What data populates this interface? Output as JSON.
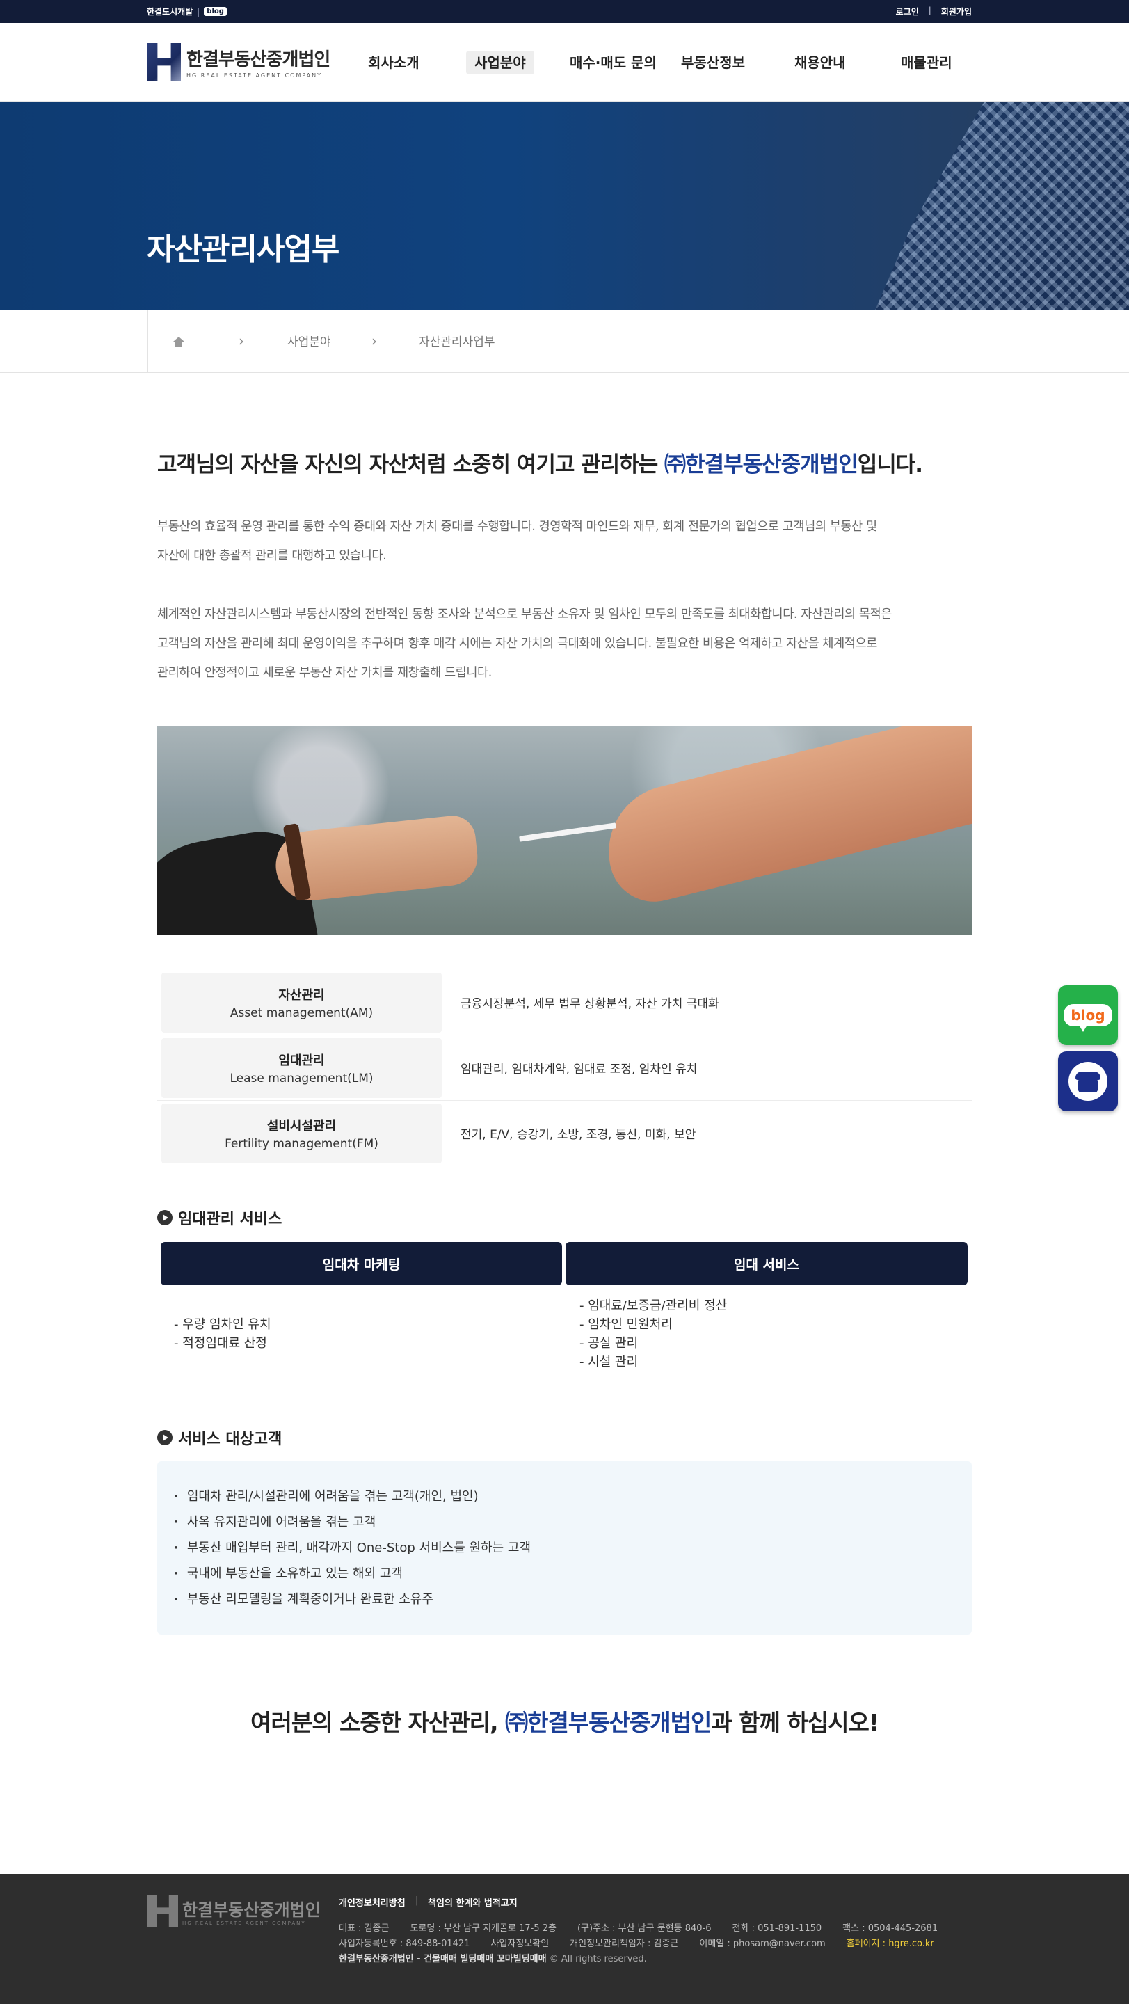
{
  "topbar": {
    "site_link": "한결도시개발",
    "blog_chip": "blog",
    "login": "로그인",
    "separator": "|",
    "signup": "회원가입"
  },
  "header": {
    "logo_ko": "한결부동산중개법인",
    "logo_en": "HG REAL ESTATE AGENT COMPANY",
    "nav": [
      "회사소개",
      "사업분야",
      "매수·매도 문의",
      "부동산정보",
      "채용안내",
      "매물관리"
    ],
    "active_nav": "사업분야"
  },
  "hero": {
    "title": "자산관리사업부"
  },
  "breadcrumb": {
    "level1": "사업분야",
    "level2": "자산관리사업부"
  },
  "intro": {
    "headline_pre": "고객님의 자산을 자신의 자산처럼 소중히 여기고 관리하는 ",
    "headline_company": "㈜한결부동산중개법인",
    "headline_post": "입니다.",
    "para1_line1": "부동산의 효율적 운영 관리를 통한 수익 증대와 자산 가치 증대를 수행합니다. 경영학적 마인드와 재무, 회계 전문가의 협업으로 고객님의 부동산 및",
    "para1_line2": "자산에 대한 총괄적 관리를 대행하고 있습니다.",
    "para2_line1": "체계적인 자산관리시스템과 부동산시장의 전반적인 동향 조사와 분석으로 부동산 소유자 및 임차인 모두의 만족도를 최대화합니다. 자산관리의 목적은",
    "para2_line2": "고객님의 자산을 관리해 최대 운영이익을 추구하며 향후 매각 시에는 자산 가치의 극대화에 있습니다. 불필요한 비용은 억제하고 자산을 체계적으로",
    "para2_line3": "관리하여 안정적이고 새로운 부동산 자산 가치를 재창출해 드립니다."
  },
  "services": [
    {
      "name_ko": "자산관리",
      "name_en": "Asset management(AM)",
      "desc": "금융시장분석, 세무 법무 상황분석, 자산 가치 극대화"
    },
    {
      "name_ko": "임대관리",
      "name_en": "Lease management(LM)",
      "desc": "임대관리, 임대차계약, 임대료 조정, 임차인 유치"
    },
    {
      "name_ko": "설비시설관리",
      "name_en": "Fertility management(FM)",
      "desc": "전기, E/V, 승강기, 소방, 조경, 통신, 미화, 보안"
    }
  ],
  "lease_section": {
    "title": "임대관리 서비스",
    "col1_head": "임대차 마케팅",
    "col1_items": [
      "- 우량 임차인 유치",
      "- 적정임대료 산정"
    ],
    "col2_head": "임대 서비스",
    "col2_items": [
      "- 임대료/보증금/관리비 정산",
      "- 임차인 민원처리",
      "- 공실 관리",
      "- 시설 관리"
    ]
  },
  "targets_section": {
    "title": "서비스 대상고객",
    "items": [
      "임대차 관리/시설관리에 어려움을 겪는 고객(개인, 법인)",
      "사옥 유지관리에 어려움을 겪는 고객",
      "부동산 매입부터 관리, 매각까지 One-Stop 서비스를 원하는 고객",
      "국내에 부동산을 소유하고 있는 해외 고객",
      "부동산 리모델링을 계획중이거나 완료한 소유주"
    ]
  },
  "closing": {
    "pre": "여러분의 소중한 자산관리, ",
    "company": "㈜한결부동산중개법인",
    "post": "과 함께 하십시오!"
  },
  "quick": {
    "blog_label": "blog"
  },
  "footer": {
    "logo_ko": "한결부동산중개법인",
    "logo_en": "HG REAL ESTATE AGENT COMPANY",
    "privacy": "개인정보처리방침",
    "link_sep": "|",
    "disclaimer": "책임의 한계와 법적고지",
    "ceo": "대표 : 김종근",
    "road_addr": "도로명 : 부산 남구 지게골로 17-5 2층",
    "old_addr": "(구)주소 : 부산 남구 문현동 840-6",
    "tel": "전화 : 051-891-1150",
    "fax": "팩스 : 0504-445-2681",
    "biz_no": "사업자등록번호 : 849-88-01421",
    "biz_check": "사업자정보확인",
    "privacy_officer": "개인정보관리책임자 : 김종근",
    "email": "이메일 : phosam@naver.com",
    "homepage": "홈페이지 : hgre.co.kr",
    "copy_bold": "한결부동산중개법인 - 건물매매 빌딩매매 꼬마빌딩매매",
    "copy_rest": " © All rights reserved."
  },
  "colors": {
    "navy": "#121c38",
    "accent_blue": "#1a3e96",
    "hero_blue": "#10427e",
    "blog_green": "#25b14a",
    "tel_blue": "#1c2f8a",
    "highlight_yellow": "#f3d03b"
  }
}
